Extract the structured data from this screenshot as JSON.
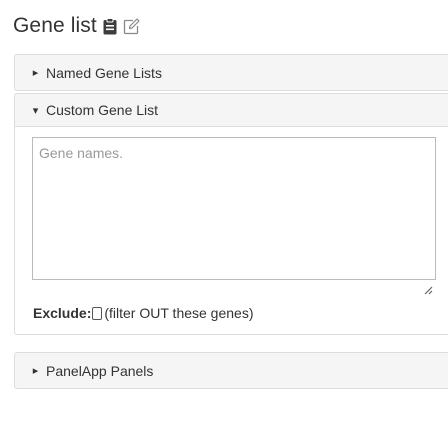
{
  "page": {
    "title": "Gene list",
    "title_icons": [
      "clipboard-icon",
      "edit-icon"
    ]
  },
  "sections": {
    "named": {
      "label": "Named Gene Lists",
      "expanded": false,
      "caret": "▸"
    },
    "custom": {
      "label": "Custom Gene List",
      "expanded": true,
      "caret": "▾",
      "gene_input": {
        "value": "",
        "placeholder": "Gene names."
      },
      "exclude": {
        "label": "Exclude:",
        "checked": false,
        "hint": "(filter OUT these genes)"
      }
    },
    "panelapp": {
      "label": "PanelApp Panels",
      "expanded": false,
      "caret": "▸"
    }
  },
  "colors": {
    "text": "#333333",
    "header_bg": "#f5f5f5",
    "border": "#dddddd",
    "placeholder": "#999999"
  }
}
